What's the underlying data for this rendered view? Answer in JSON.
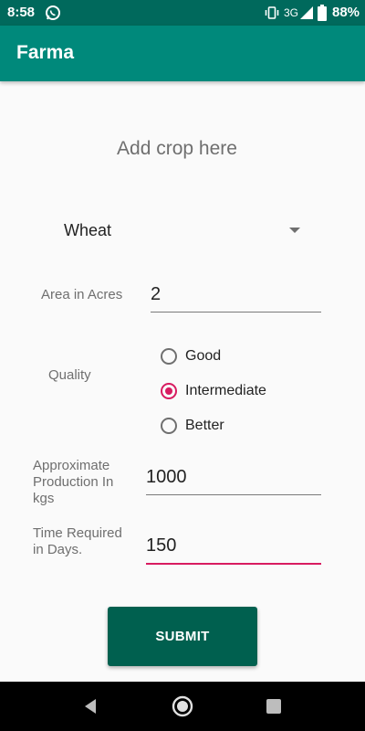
{
  "status_bar": {
    "time": "8:58",
    "network": "3G",
    "battery": "88%",
    "icons": [
      "whatsapp-icon",
      "vibrate-icon",
      "signal-icon",
      "battery-icon"
    ]
  },
  "app_bar": {
    "title": "Farma",
    "color": "#00897b"
  },
  "form": {
    "heading": "Add crop here",
    "crop_select": {
      "value": "Wheat"
    },
    "area": {
      "label": "Area in Acres",
      "value": "2"
    },
    "quality": {
      "label": "Quality",
      "options": [
        {
          "label": "Good",
          "checked": false
        },
        {
          "label": "Intermediate",
          "checked": true
        },
        {
          "label": "Better",
          "checked": false
        }
      ]
    },
    "production": {
      "label_lines": [
        "Approximate",
        "Production In",
        "kgs"
      ],
      "value": "1000"
    },
    "time_required": {
      "label_lines": [
        "Time Required",
        "in Days."
      ],
      "value": "150"
    },
    "submit_label": "SUBMIT"
  },
  "colors": {
    "primary_dark": "#00695c",
    "accent": "#d81b60",
    "button": "#00604f"
  }
}
